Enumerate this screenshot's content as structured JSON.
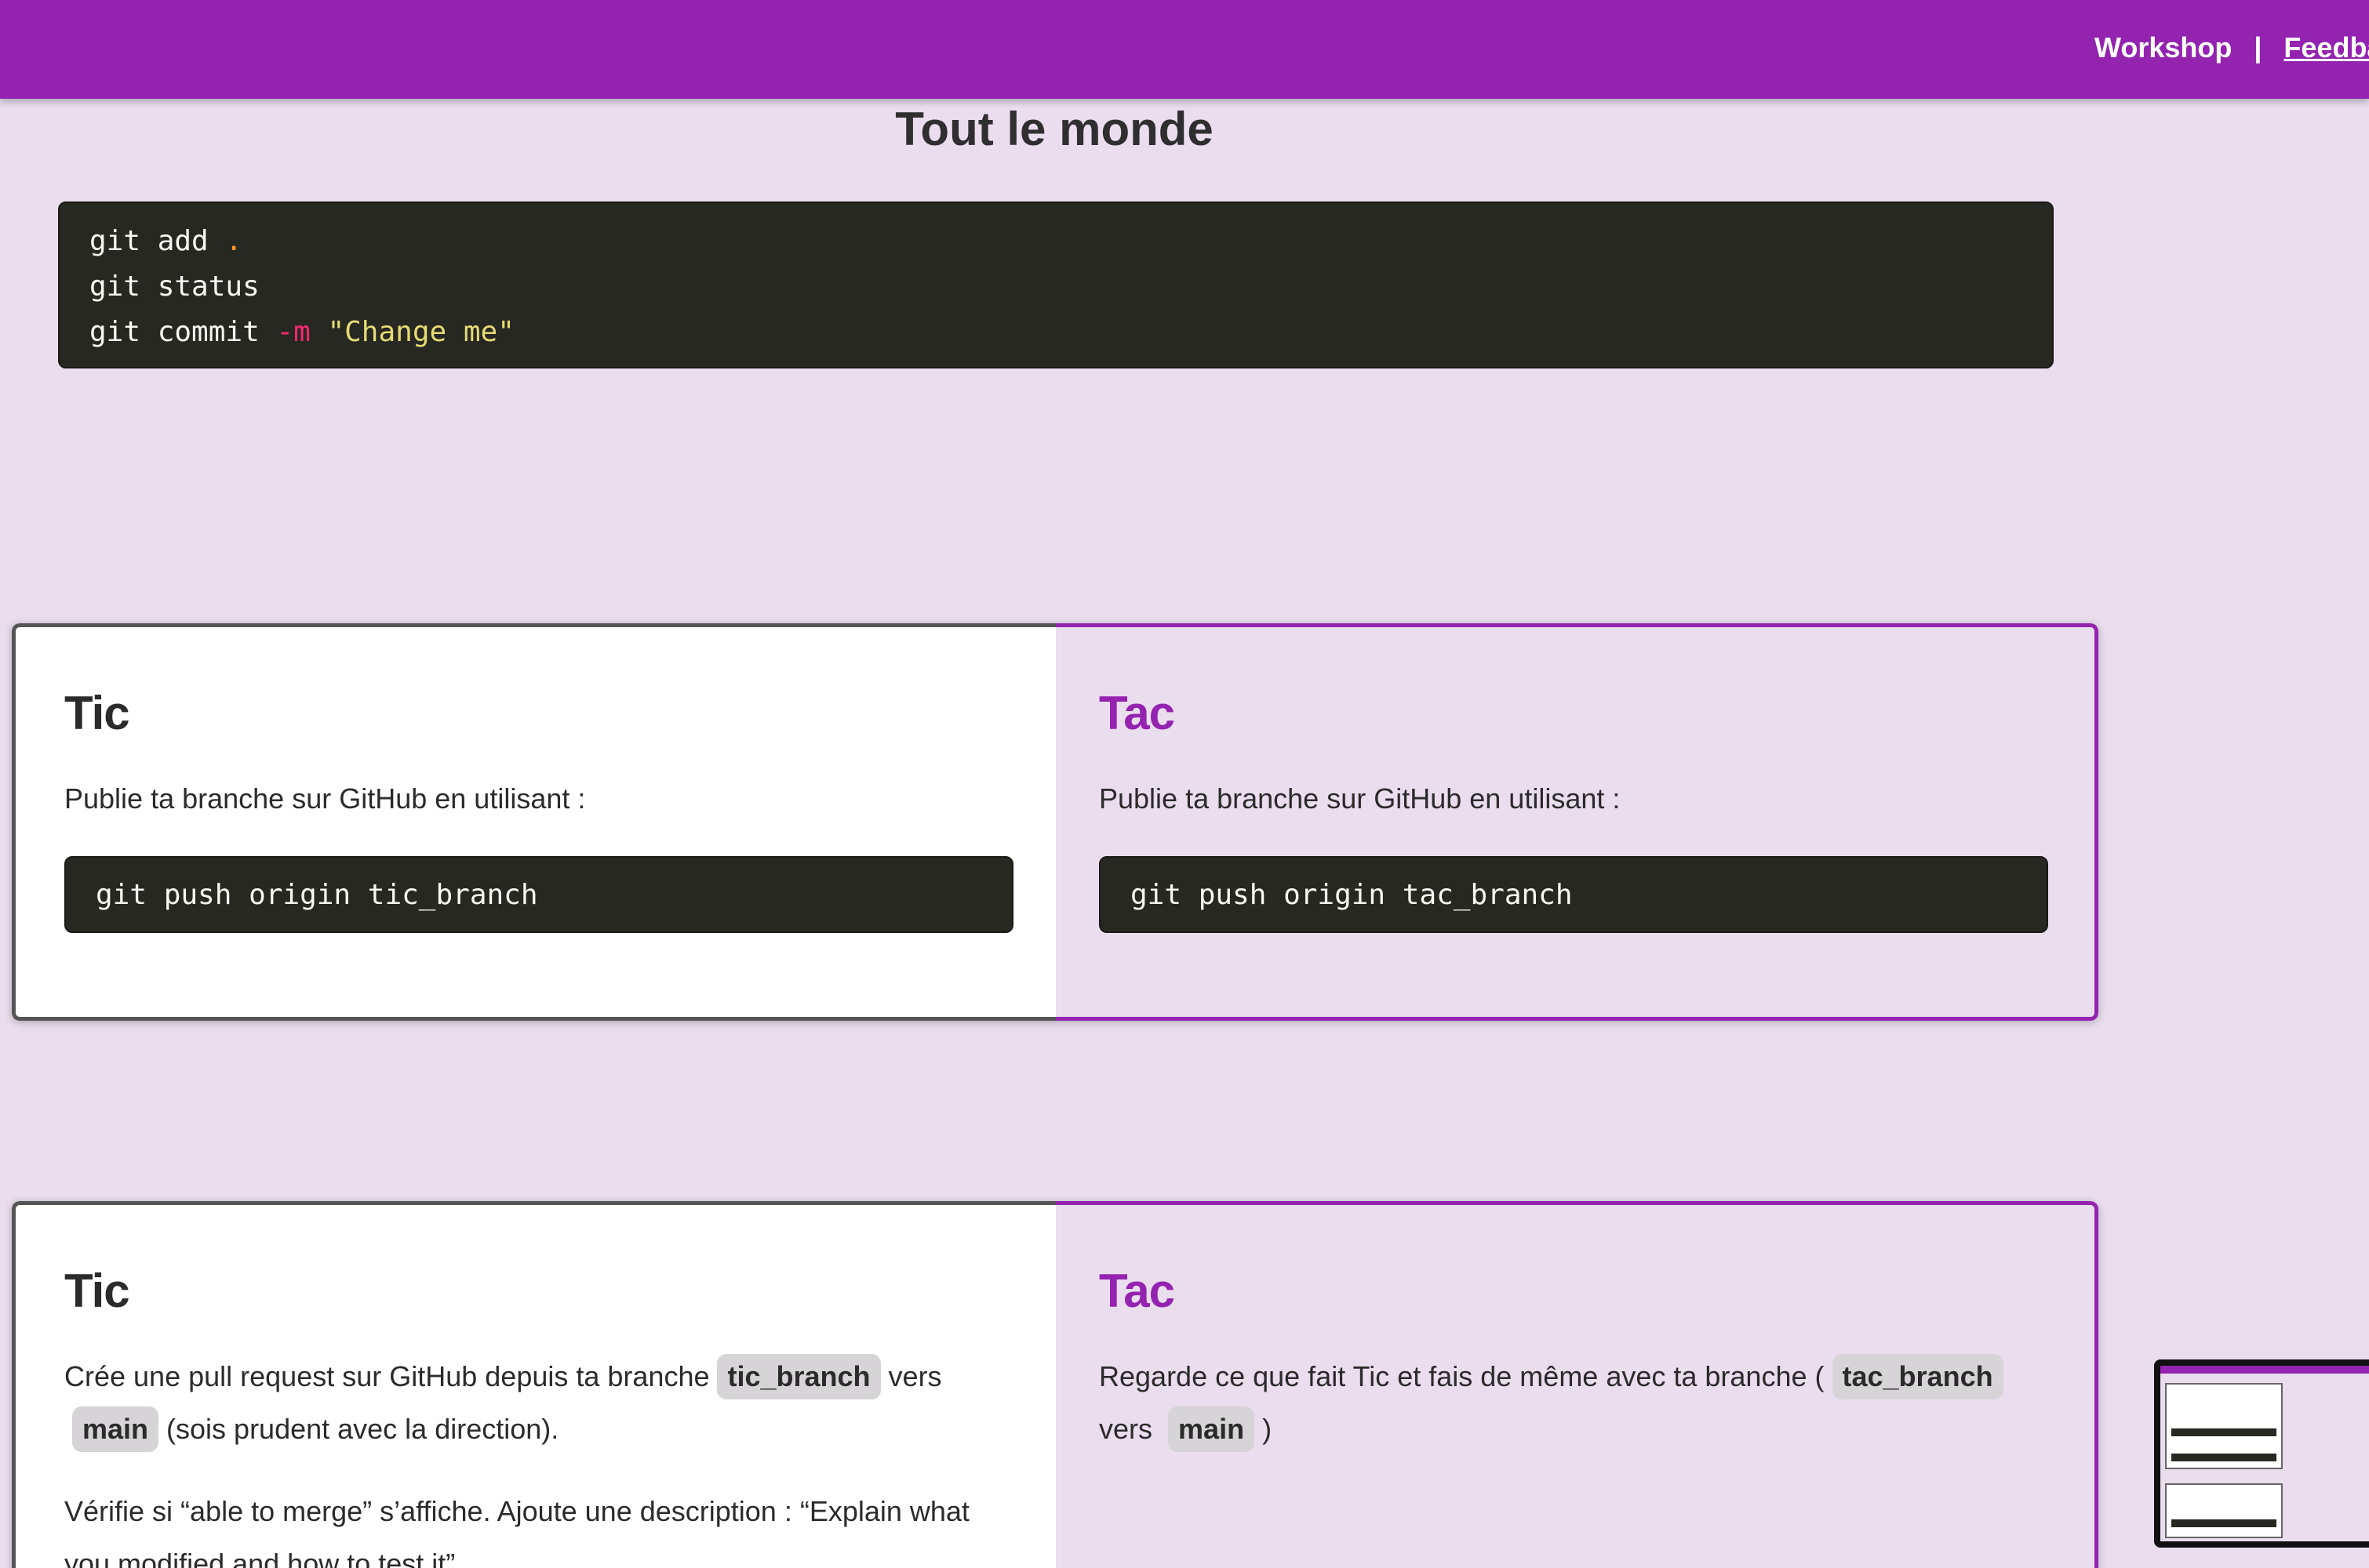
{
  "topbar": {
    "workshop_label": "Workshop",
    "separator": "|",
    "feedback_label": "Feedba"
  },
  "page_title": "Tout le monde",
  "everyone_code": {
    "lines": [
      {
        "cmd": "git add",
        "dot": " .",
        "flag": "",
        "str": ""
      },
      {
        "cmd": "git status",
        "dot": "",
        "flag": "",
        "str": ""
      },
      {
        "cmd": "git commit",
        "dot": "",
        "flag": " -m",
        "str": " \"Change me\""
      }
    ]
  },
  "step_push": {
    "tic": {
      "title": "Tic",
      "text": "Publie ta branche sur GitHub en utilisant :",
      "command": "git push origin tic_branch"
    },
    "tac": {
      "title": "Tac",
      "text": "Publie ta branche sur GitHub en utilisant :",
      "command": "git push origin tac_branch"
    }
  },
  "step_pr": {
    "tic": {
      "title": "Tic",
      "p1_before": "Crée une pull request sur GitHub depuis ta branche",
      "p1_branch": "tic_branch",
      "p1_middle": "vers",
      "p1_target": "main",
      "p1_after": "(sois prudent avec la direction).",
      "p2": "Vérifie si “able to merge” s’affiche. Ajoute une description : “Explain what you modified and how to test it”"
    },
    "tac": {
      "title": "Tac",
      "p1_before": "Regarde ce que fait Tic et fais de même avec ta branche (",
      "p1_branch": "tac_branch",
      "p1_middle": "vers",
      "p1_target": "main",
      "p1_after": ")"
    }
  },
  "colors": {
    "brand_purple": "#9423b0",
    "page_background": "#e9ddee",
    "code_background": "#272822"
  }
}
